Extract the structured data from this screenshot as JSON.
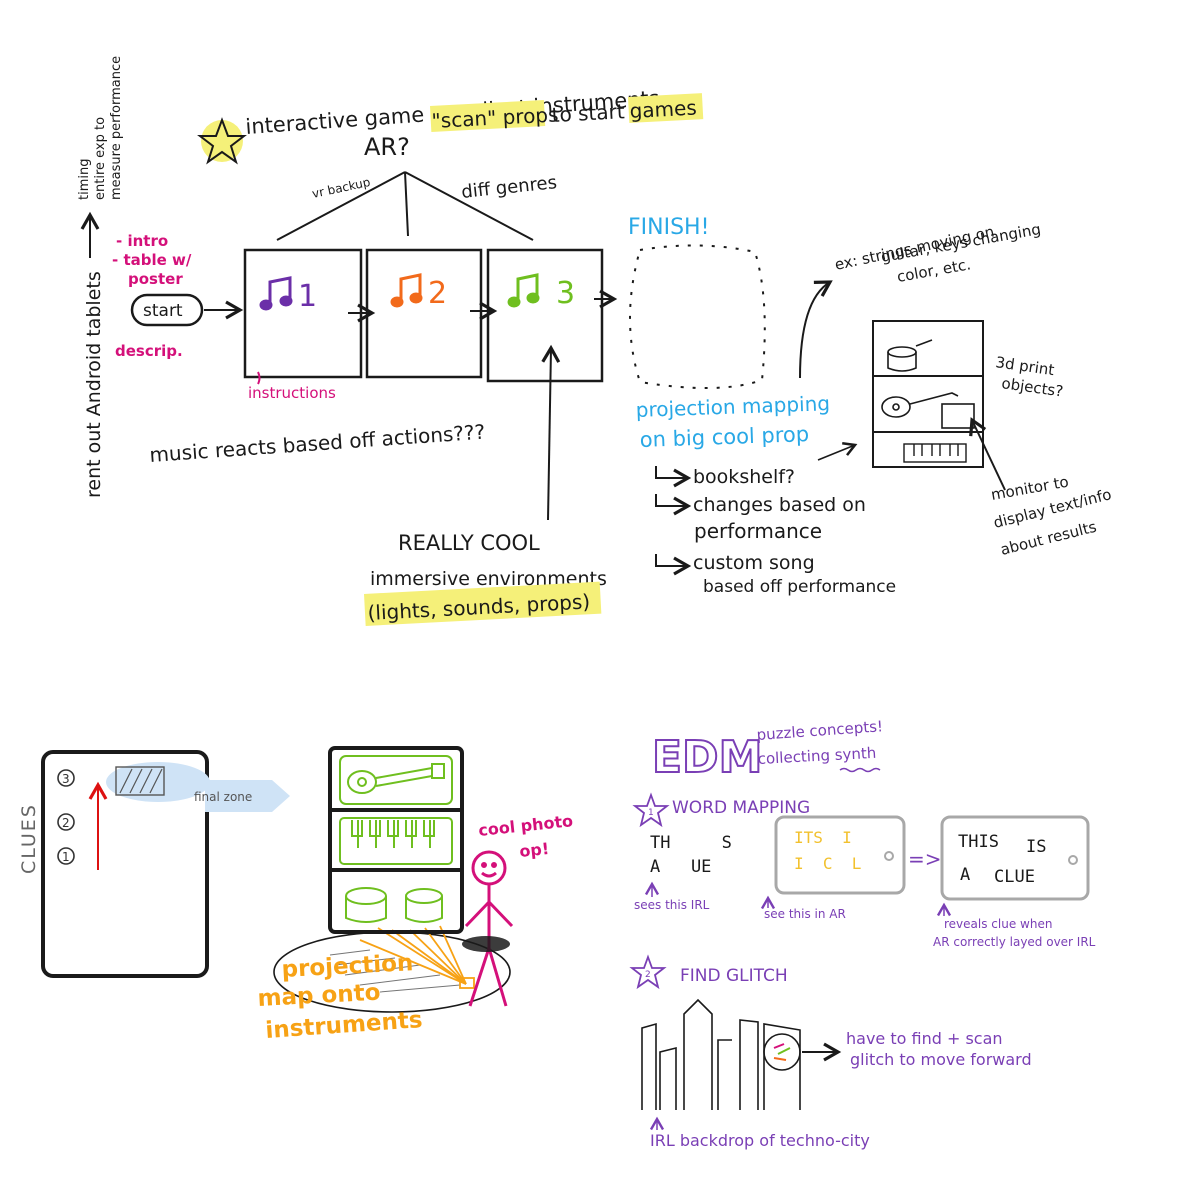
{
  "colors": {
    "ink": "#1a1a1a",
    "magenta": "#d4107a",
    "purple": "#7a3fb5",
    "purple_note": "#5b2ca0",
    "orange": "#f26a1b",
    "green": "#6fbf1f",
    "sky": "#29a8e6",
    "yellow": "#f5f079",
    "amber": "#f7a215",
    "pale_blue": "#cfe3f6",
    "grey": "#9a9a9a"
  },
  "icons": [
    "star-icon",
    "music-note-icon",
    "arrow-icon",
    "stick-figure-icon",
    "guitar-icon",
    "keyboard-icon",
    "drum-icon",
    "tablet-icon",
    "glitch-icon"
  ],
  "side_note": {
    "line1": "rent out Android tablets",
    "timing1": "timing",
    "timing2": "entire exp to",
    "timing3": "measure performance"
  },
  "top": {
    "title": "interactive game to collect instruments",
    "ar": "AR?",
    "scan_props": "\"scan\" props",
    "to_start": "to start",
    "games": "games",
    "vr_backup": "vr backup",
    "diff_genres": "diff genres",
    "finish": "FINISH!",
    "intro": "- intro",
    "table_w": "- table w/",
    "poster": "poster",
    "start": "start",
    "descrip": "descrip.",
    "instructions": "instructions",
    "stage1": "1",
    "stage2": "2",
    "stage3": "3",
    "music_reacts": "music reacts based off actions???",
    "really_cool": "REALLY COOL",
    "immersive": "immersive environments",
    "lights": "(lights, sounds, props)",
    "projection1": "projection mapping",
    "projection2": "on big cool prop",
    "bookshelf": "bookshelf?",
    "changes1": "changes based on",
    "changes2": "performance",
    "custom_song": "custom song",
    "based_off": "based off performance",
    "ex1": "ex: strings moving on",
    "ex2": "guitar, keys changing",
    "ex3": "color, etc.",
    "print1": "3d print",
    "print2": "objects?",
    "monitor1": "monitor to",
    "monitor2": "display text/info",
    "monitor3": "about results"
  },
  "bottom_left": {
    "clues": "CLUES",
    "c3": "3",
    "c2": "2",
    "c1": "1",
    "final_zone": "final zone",
    "cool_photo": "cool photo",
    "op": "op!",
    "proj1": "projection",
    "proj2": "map onto",
    "proj3": "instruments"
  },
  "bottom_right": {
    "edm": "EDM",
    "puzzle": "puzzle concepts!",
    "collecting": "collecting synth",
    "n1": "1",
    "word_mapping": "WORD MAPPING",
    "irl1": "TH     S",
    "irl2": "A   UE",
    "sees_irl": "sees this IRL",
    "ar1": "ITS  I",
    "ar2": "I  C  L",
    "see_ar": "see this in AR",
    "res1": "THIS",
    "res2": "IS",
    "res3": "A",
    "res4": "CLUE",
    "reveals1": "reveals clue when",
    "reveals2": "AR correctly layed over IRL",
    "n2": "2",
    "find_glitch": "FIND GLITCH",
    "have1": "have to find + scan",
    "have2": "glitch to move forward",
    "backdrop": "IRL backdrop of techno-city"
  }
}
